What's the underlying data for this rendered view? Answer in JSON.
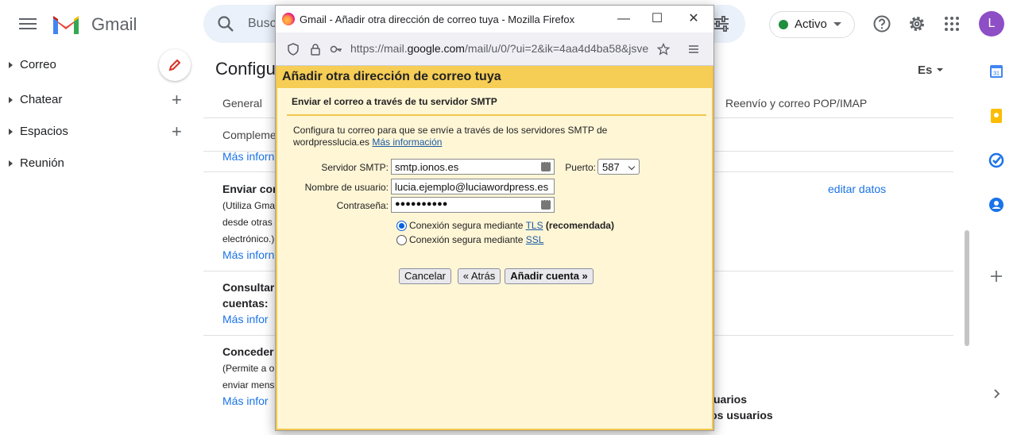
{
  "gmail": {
    "logo_text": "Gmail",
    "search_placeholder": "Busc",
    "status": "Activo",
    "avatar_letter": "L",
    "colors": {
      "search_bg": "#eaf1fb",
      "status_green": "#1e8e3e",
      "avatar": "#8e4ec6",
      "link": "#1a73e8"
    }
  },
  "sidebar": {
    "items": [
      {
        "label": "Correo"
      },
      {
        "label": "Chatear"
      },
      {
        "label": "Espacios"
      },
      {
        "label": "Reunión"
      }
    ]
  },
  "settings": {
    "title": "Configu",
    "language": "Es",
    "tabs": {
      "general": "General",
      "forwarding": "Reenvío y correo POP/IMAP",
      "complements": "Compleme"
    },
    "more_info": "Más inforn",
    "more_info_short": "Más infor",
    "send_as_title": "Enviar cor",
    "send_as_desc": [
      "(Utiliza Gma",
      "desde otras",
      "electrónico.)"
    ],
    "edit_data": "editar datos",
    "check_mail_title": [
      "Consultar",
      "cuentas:"
    ],
    "grant_access_title": "Conceder a",
    "grant_access_desc": [
      "(Permite a o",
      "enviar mens"
    ],
    "frag_users_1": "uarios",
    "frag_users_2": "tros usuarios"
  },
  "firefox": {
    "title": "Gmail - Añadir otra dirección de correo tuya - Mozilla Firefox",
    "url_prefix": "https://mail.",
    "url_domain": "google.com",
    "url_rest": "/mail/u/0/?ui=2&ik=4aa4d4ba58&jsve",
    "controls": {
      "minimize": "—",
      "maximize": "☐",
      "close": "✕"
    }
  },
  "dialog": {
    "title": "Añadir otra dirección de correo tuya",
    "subtitle": "Enviar el correo a través de tu servidor SMTP",
    "description": "Configura tu correo para que se envíe a través de los servidores SMTP de wordpresslucia.es",
    "description_link": "Más información",
    "smtp_label": "Servidor SMTP:",
    "smtp_value": "smtp.ionos.es",
    "port_label": "Puerto:",
    "port_value": "587",
    "user_label": "Nombre de usuario:",
    "user_value": "lucia.ejemplo@luciawordpress.es",
    "pass_label": "Contraseña:",
    "pass_value": "●●●●●●●●●●",
    "tls_text": "Conexión segura mediante",
    "tls_link": "TLS",
    "tls_rec": "(recomendada)",
    "ssl_text": "Conexión segura mediante",
    "ssl_link": "SSL",
    "cancel": "Cancelar",
    "back": "« Atrás",
    "add": "Añadir cuenta »",
    "colors": {
      "bg": "#fff6d6",
      "header": "#f6cd55",
      "border": "#f3c74d"
    }
  }
}
